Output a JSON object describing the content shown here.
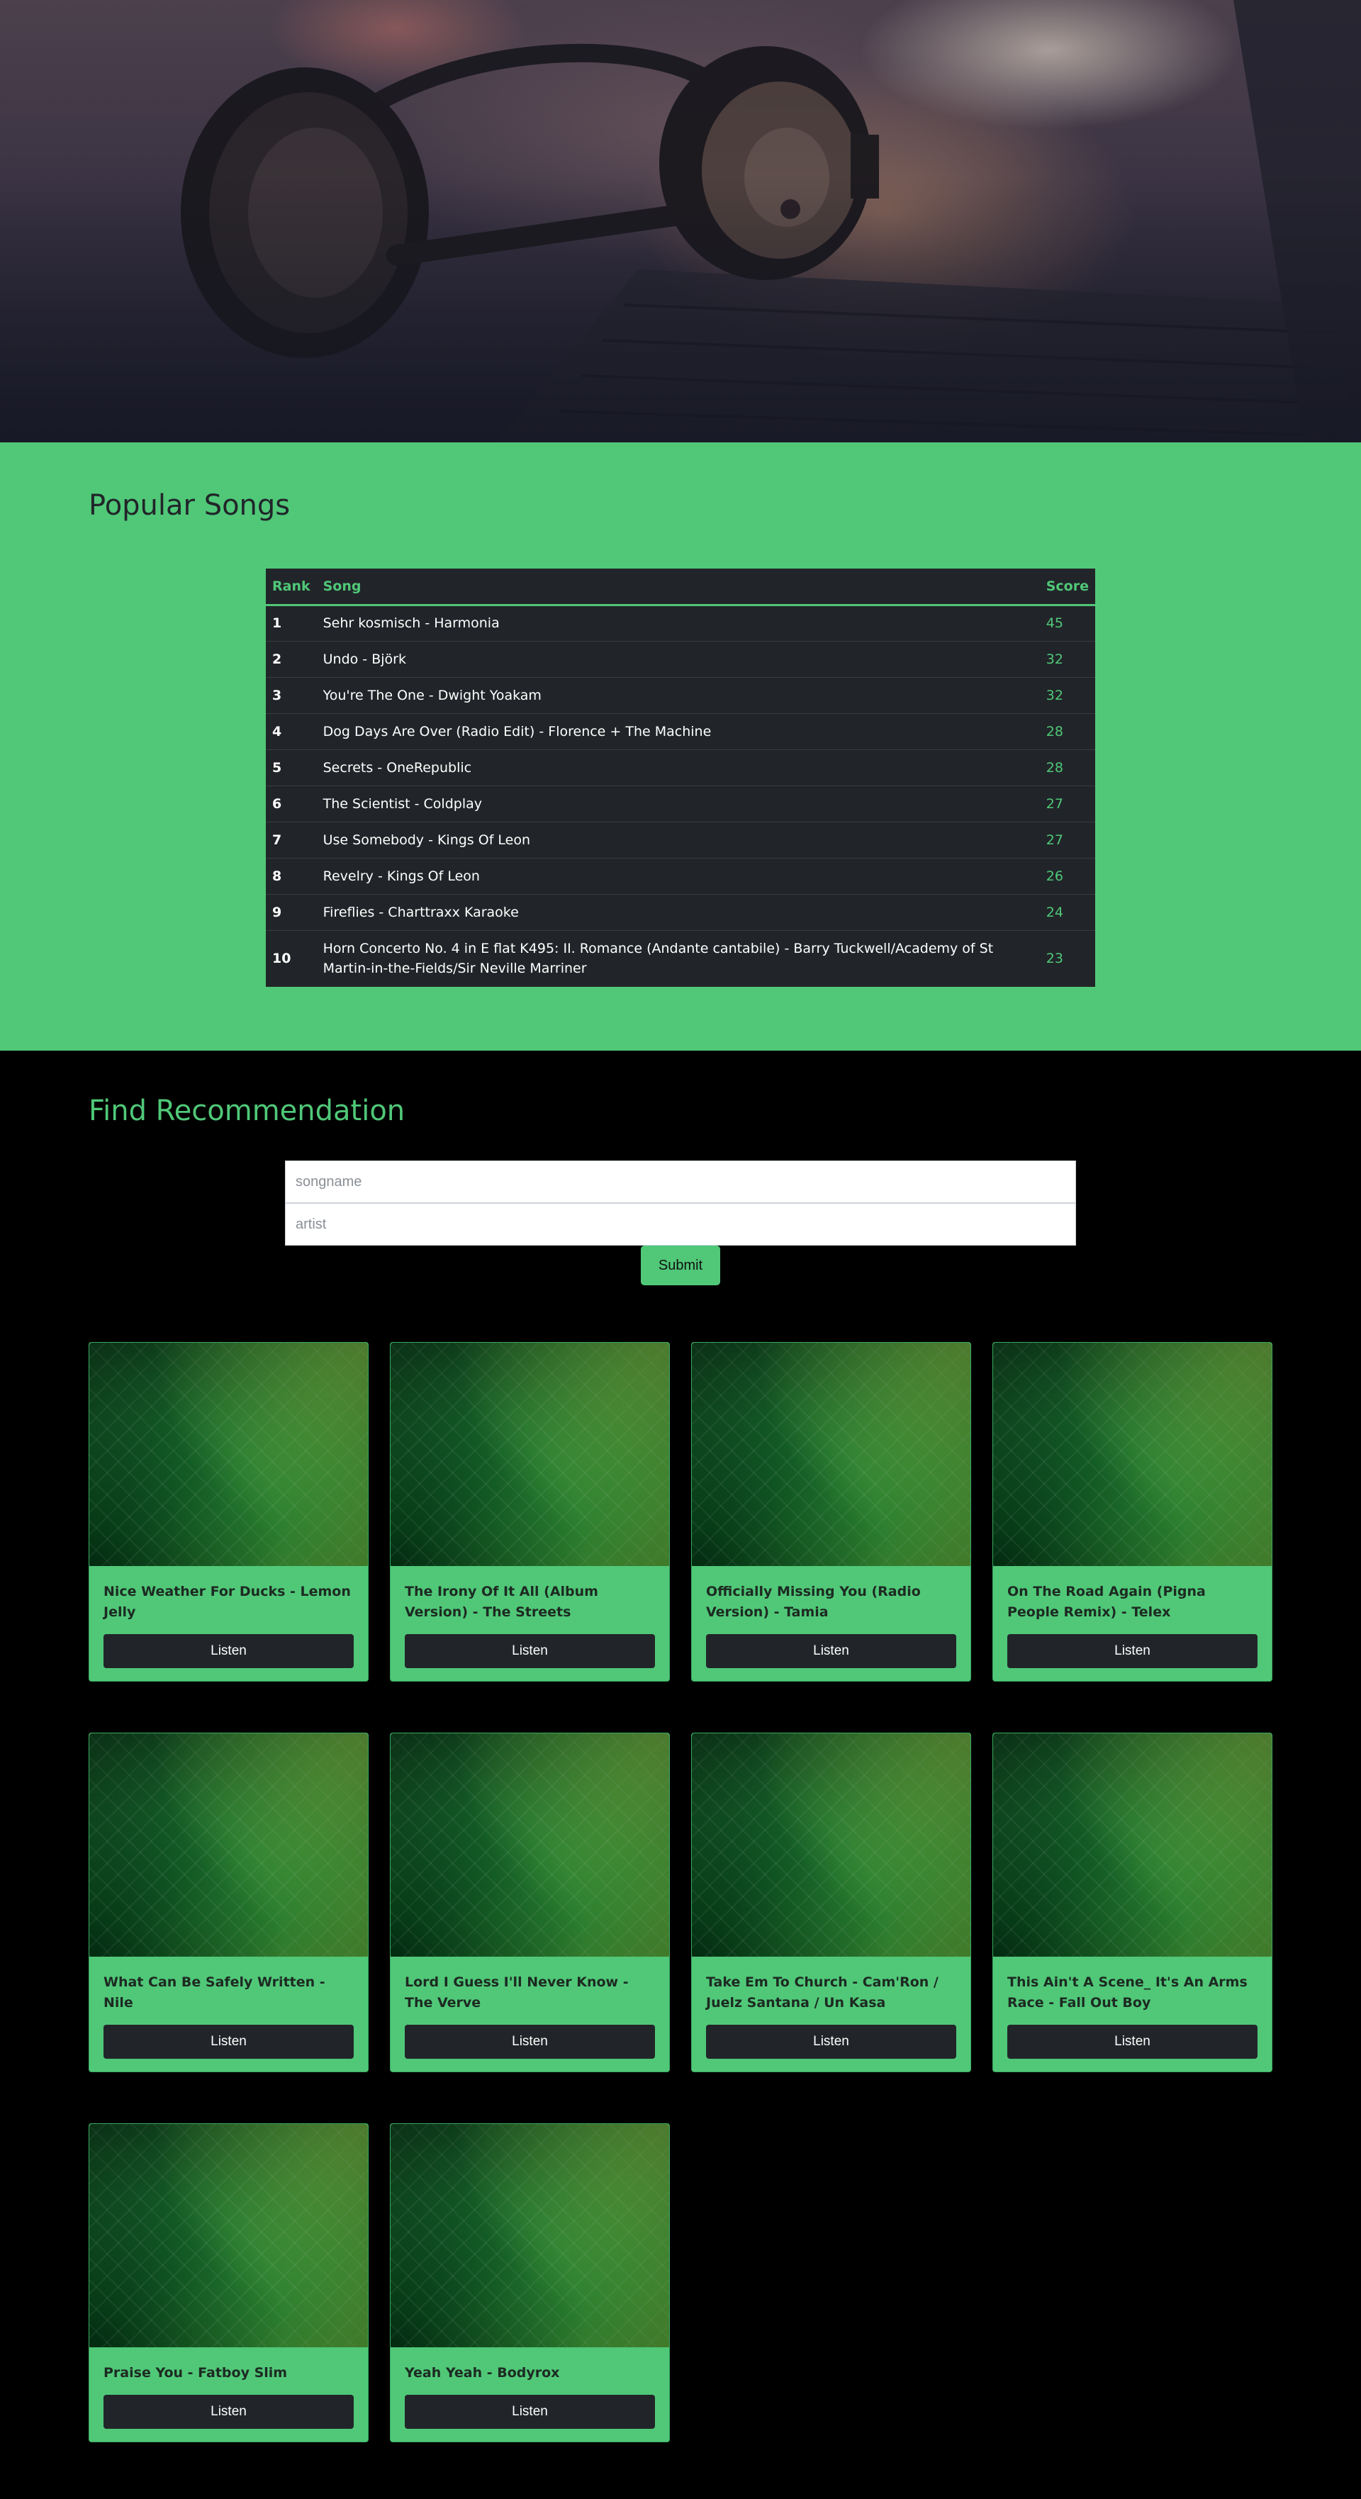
{
  "popular": {
    "title": "Popular Songs",
    "columns": [
      "Rank",
      "Song",
      "Score"
    ],
    "rows": [
      {
        "rank": "1",
        "song": "Sehr kosmisch - Harmonia",
        "score": "45"
      },
      {
        "rank": "2",
        "song": "Undo - Björk",
        "score": "32"
      },
      {
        "rank": "3",
        "song": "You're The One - Dwight Yoakam",
        "score": "32"
      },
      {
        "rank": "4",
        "song": "Dog Days Are Over (Radio Edit) - Florence + The Machine",
        "score": "28"
      },
      {
        "rank": "5",
        "song": "Secrets - OneRepublic",
        "score": "28"
      },
      {
        "rank": "6",
        "song": "The Scientist - Coldplay",
        "score": "27"
      },
      {
        "rank": "7",
        "song": "Use Somebody - Kings Of Leon",
        "score": "27"
      },
      {
        "rank": "8",
        "song": "Revelry - Kings Of Leon",
        "score": "26"
      },
      {
        "rank": "9",
        "song": "Fireflies - Charttraxx Karaoke",
        "score": "24"
      },
      {
        "rank": "10",
        "song": "Horn Concerto No. 4 in E flat K495: II. Romance (Andante cantabile) - Barry Tuckwell/Academy of St Martin-in-the-Fields/Sir Neville Marriner",
        "score": "23"
      }
    ]
  },
  "find": {
    "title": "Find Recommendation",
    "songname_placeholder": "songname",
    "artist_placeholder": "artist",
    "submit_label": "Submit"
  },
  "recommendations": [
    {
      "title": "Nice Weather For Ducks - Lemon Jelly",
      "button": "Listen"
    },
    {
      "title": "The Irony Of It All (Album Version) - The Streets",
      "button": "Listen"
    },
    {
      "title": "Officially Missing You (Radio Version) - Tamia",
      "button": "Listen"
    },
    {
      "title": "On The Road Again (Pigna People Remix) - Telex",
      "button": "Listen"
    },
    {
      "title": "What Can Be Safely Written - Nile",
      "button": "Listen"
    },
    {
      "title": "Lord I Guess I'll Never Know - The Verve",
      "button": "Listen"
    },
    {
      "title": "Take Em To Church - Cam'Ron / Juelz Santana / Un Kasa",
      "button": "Listen"
    },
    {
      "title": "This Ain't A Scene_ It's An Arms Race - Fall Out Boy",
      "button": "Listen"
    },
    {
      "title": "Praise You - Fatboy Slim",
      "button": "Listen"
    },
    {
      "title": "Yeah Yeah - Bodyrox",
      "button": "Listen"
    }
  ],
  "colors": {
    "accent": "#50c878",
    "dark": "#212529",
    "background": "#000000"
  }
}
